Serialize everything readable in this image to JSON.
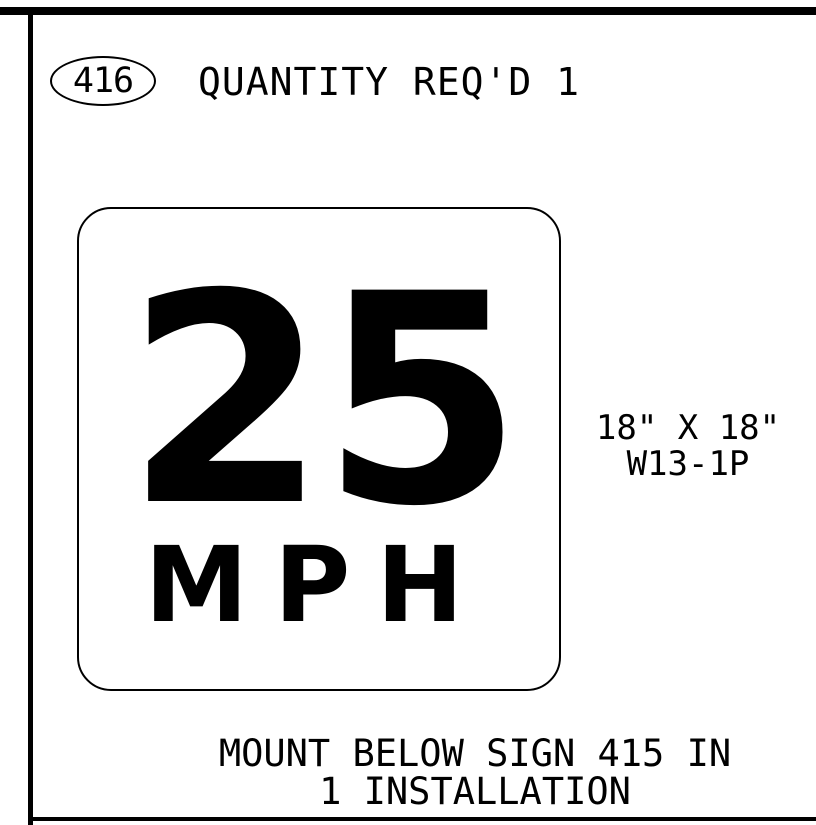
{
  "sign_callout": {
    "number": "416",
    "quantity_label": "QUANTITY REQ'D 1"
  },
  "sign_face": {
    "speed": "25",
    "unit": "MPH",
    "border_color": "#000000",
    "background_color": "#ffffff",
    "legend_color": "#000000"
  },
  "sign_spec": {
    "size": "18\" X 18\"",
    "code": "W13-1P"
  },
  "note": {
    "line1": "MOUNT BELOW SIGN 415 IN",
    "line2": "1 INSTALLATION"
  }
}
